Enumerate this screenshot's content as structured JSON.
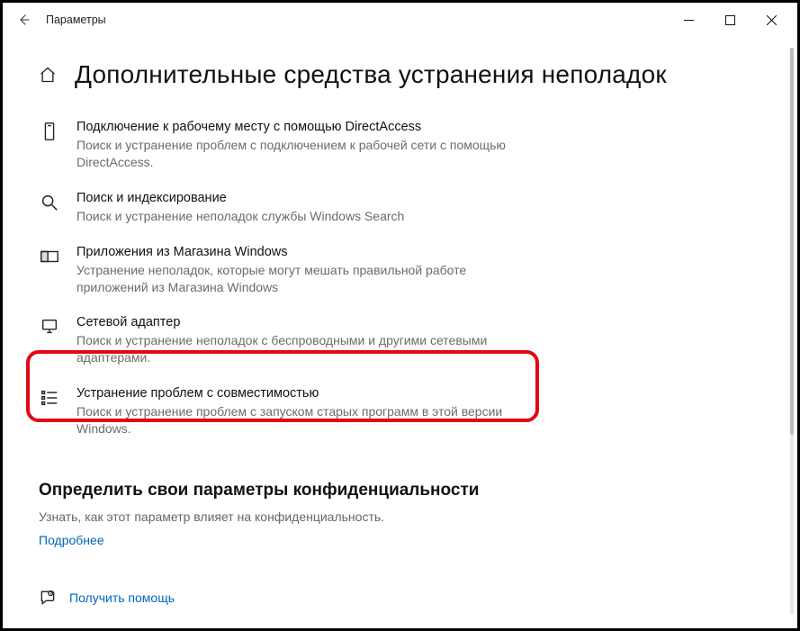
{
  "window": {
    "title": "Параметры"
  },
  "page_title": "Дополнительные средства устранения неполадок",
  "items": [
    {
      "title": "Подключение к рабочему месту с помощью DirectAccess",
      "desc": "Поиск и устранение проблем с подключением к рабочей сети с помощью DirectAccess."
    },
    {
      "title": "Поиск и индексирование",
      "desc": "Поиск и устранение неполадок службы Windows Search"
    },
    {
      "title": "Приложения из Магазина Windows",
      "desc": "Устранение неполадок, которые могут мешать правильной работе приложений из Магазина Windows"
    },
    {
      "title": "Сетевой адаптер",
      "desc": "Поиск и устранение неполадок с беспроводными и другими сетевыми адаптерами."
    },
    {
      "title": "Устранение проблем с совместимостью",
      "desc": "Поиск и устранение проблем с запуском старых программ в этой версии Windows."
    }
  ],
  "privacy": {
    "heading": "Определить свои параметры конфиденциальности",
    "desc": "Узнать, как этот параметр влияет на конфиденциальность.",
    "more": "Подробнее"
  },
  "help_link": "Получить помощь"
}
